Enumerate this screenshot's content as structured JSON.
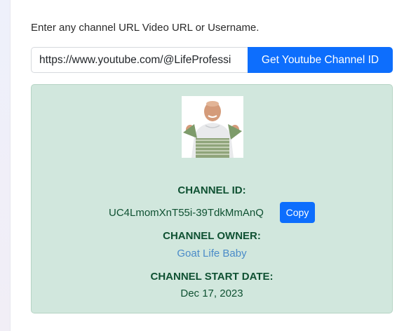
{
  "form": {
    "instruction": "Enter any channel URL Video URL or Username.",
    "input_value": "https://www.youtube.com/@LifeProfessi",
    "submit_label": "Get Youtube Channel ID"
  },
  "result": {
    "channel_id_label": "CHANNEL ID:",
    "channel_id": "UC4LmomXnT55i-39TdkMmAnQ",
    "copy_label": "Copy",
    "owner_label": "CHANNEL OWNER:",
    "owner_name": "Goat Life Baby",
    "start_date_label": "CHANNEL START DATE:",
    "start_date": "Dec 17, 2023"
  },
  "colors": {
    "accent": "#0d6efd",
    "card_background": "#d1e7dd",
    "card_text": "#0f5132",
    "link": "#4a8bc8"
  }
}
